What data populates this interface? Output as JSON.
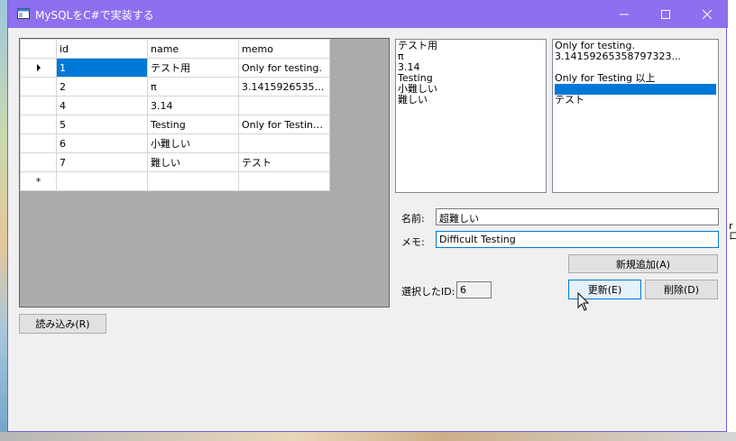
{
  "window": {
    "title": "MySQLをC#で実装する"
  },
  "grid": {
    "columns": [
      "id",
      "name",
      "memo"
    ],
    "rows": [
      {
        "id": "1",
        "name": "テスト用",
        "memo": "Only for testing."
      },
      {
        "id": "2",
        "name": "π",
        "memo": "3.14159265358797323..."
      },
      {
        "id": "4",
        "name": "3.14",
        "memo": ""
      },
      {
        "id": "5",
        "name": "Testing",
        "memo": "Only for Testing 以上"
      },
      {
        "id": "6",
        "name": "小難しい",
        "memo": ""
      },
      {
        "id": "7",
        "name": "難しい",
        "memo": "テスト"
      }
    ],
    "new_row_marker": "*"
  },
  "list_names": [
    "テスト用",
    "π",
    "3.14",
    "Testing",
    "小難しい",
    "難しい"
  ],
  "list_memos": [
    "Only for testing.",
    "3.14159265358797323...",
    "",
    "Only for Testing 以上",
    "",
    "テスト"
  ],
  "form": {
    "name_label": "名前:",
    "name_value": "超難しい",
    "memo_label": "メモ:",
    "memo_value": "Difficult Testing",
    "selected_id_label": "選択したID:",
    "selected_id_value": "6",
    "add_button": "新規追加(A)",
    "update_button": "更新(E)",
    "delete_button": "削除(D)",
    "load_button": "読み込み(R)"
  },
  "desktop": {
    "right_edge_text": "r\nロ"
  },
  "colors": {
    "titlebar": "#8d6ff0",
    "selection": "#0078d7"
  }
}
